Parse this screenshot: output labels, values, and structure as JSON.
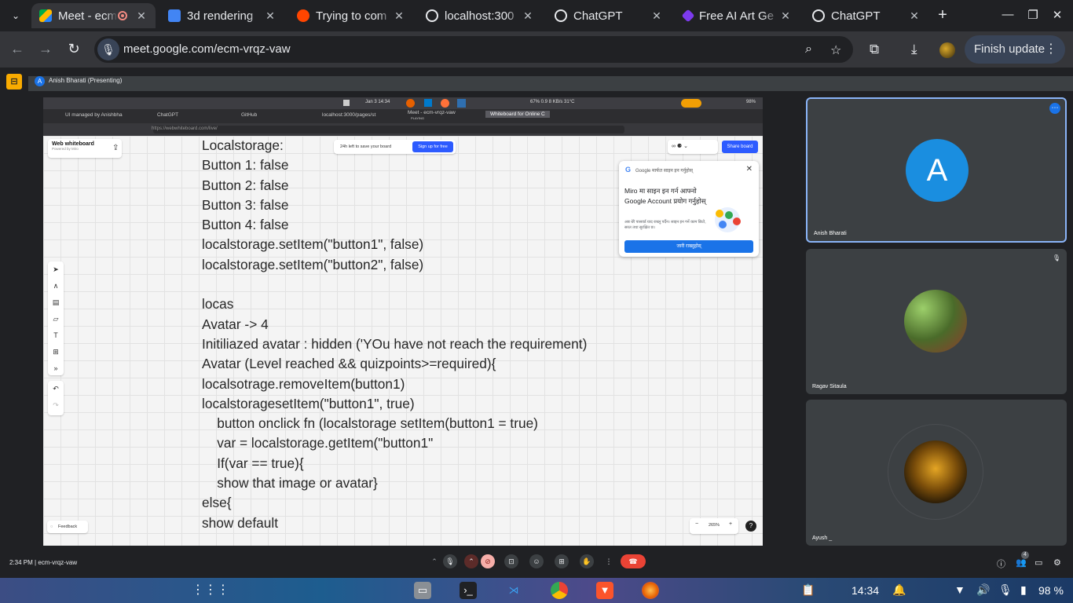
{
  "browser": {
    "tabs": [
      {
        "title": "Meet - ecm",
        "active": true
      },
      {
        "title": "3d rendering"
      },
      {
        "title": "Trying to com"
      },
      {
        "title": "localhost:300"
      },
      {
        "title": "ChatGPT"
      },
      {
        "title": "Free AI Art Ge"
      },
      {
        "title": "ChatGPT"
      }
    ],
    "url": "meet.google.com/ecm-vrqz-vaw",
    "finish_update": "Finish update"
  },
  "meet": {
    "presenter": "Anish Bharati (Presenting)",
    "presenter_initial": "A",
    "time_code": "2:34 PM  |  ecm-vrqz-vaw",
    "participants_badge": "4",
    "participants": [
      {
        "name": "Anish Bharati",
        "initial": "A"
      },
      {
        "name": "Ragav Sitaula"
      },
      {
        "name": "Ayush _"
      }
    ]
  },
  "shared": {
    "topbar": {
      "date": "Jan 3  14:34",
      "stats": "67%  0.9  8 KB/s  31°C",
      "battery": "98%"
    },
    "tabs": [
      "UI managed by Anishbha",
      "ChatGPT",
      "GitHub",
      "localhost:3000/pages/st",
      "Meet - ecm-vrqz-vaw",
      "Whiteboard for Online C"
    ],
    "tab_sub": "PLAYING",
    "url": "https://webwhiteboard.com/live/",
    "logo_title": "Web whiteboard",
    "logo_sub": "Powered by Miro",
    "save_note": "24h left to save your board",
    "signup": "Sign up for free",
    "share_board": "Share board",
    "popup": {
      "header": "Google मार्फत साइन इन गर्नुहोस्",
      "title": "Miro मा साइन इन गर्न आफ्नो Google Account प्रयोग गर्नुहोस्",
      "desc": "अब धेरै पासवर्ड याद राख्नु पर्दैन। साइन इन गर्ने काम छिटो, सरल तथा सुरक्षित छ।",
      "button": "जारी राख्नुहोस्"
    },
    "feedback": "Feedback",
    "zoom": "265%",
    "lines": [
      "Localstorage:",
      "Button 1: false",
      "Button 2: false",
      "Button 3: false",
      "Button 4: false",
      "localstorage.setItem(\"button1\", false)",
      "localstorage.setItem(\"button2\", false)",
      "",
      "locas",
      "Avatar -> 4",
      "Initiliazed avatar : hidden ('YOu have not reach the requirement)",
      "Avatar (Level reached && quizpoints>=required){",
      "localsotrage.removeItem(button1)",
      "localstoragesetItem(\"button1\", true)",
      "    button onclick fn (localstorage setItem(button1 = true)",
      "    var = localstorage.getItem(\"button1\"",
      "    If(var == true){",
      "    show that image or avatar}",
      "else{",
      "show default"
    ]
  },
  "shelf": {
    "time": "14:34",
    "battery": "98 %"
  },
  "colors": {
    "accent": "#8ab4f8",
    "end_call": "#ea4335",
    "avatar": "#1a8ee0"
  }
}
